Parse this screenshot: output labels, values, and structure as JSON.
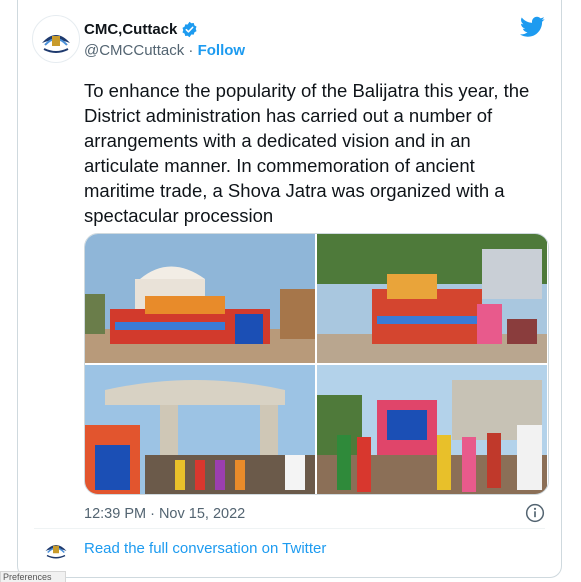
{
  "tweet": {
    "author_name": "CMC,Cuttack",
    "handle": "@CMCCuttack",
    "separator": " · ",
    "follow_label": "Follow",
    "text": "To enhance the popularity of the Balijatra this year, the District administration has carried out a number of arrangements with a dedicated vision and in an articulate manner. In commemoration of ancient maritime trade, a Shova Jatra was organized with a spectacular procession",
    "timestamp": "12:39 PM · Nov 15, 2022",
    "read_more_label": "Read the full conversation on Twitter"
  },
  "icons": {
    "brand": "twitter-bird-icon",
    "verified": "verified-badge-icon",
    "info": "info-icon"
  },
  "colors": {
    "accent": "#1d9bf0",
    "text": "#0f1419",
    "secondary": "#536471"
  },
  "footer": {
    "corner_text": "Preferences"
  }
}
